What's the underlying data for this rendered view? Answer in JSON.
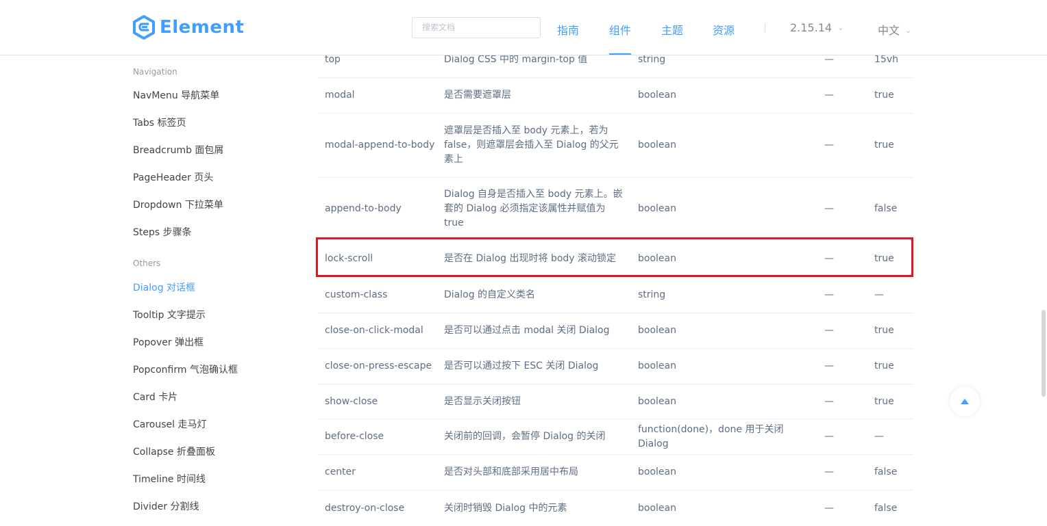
{
  "header": {
    "logo_text": "Element",
    "search_placeholder": "搜索文档",
    "nav": [
      "指南",
      "组件",
      "主题",
      "资源"
    ],
    "active_nav": "组件",
    "version": "2.15.14",
    "language": "中文",
    "accent_color": "#409eff"
  },
  "sidebar": {
    "groups": [
      {
        "title": "Navigation",
        "items": [
          "NavMenu 导航菜单",
          "Tabs 标签页",
          "Breadcrumb 面包屑",
          "PageHeader 页头",
          "Dropdown 下拉菜单",
          "Steps 步骤条"
        ]
      },
      {
        "title": "Others",
        "items": [
          "Dialog 对话框",
          "Tooltip 文字提示",
          "Popover 弹出框",
          "Popconfirm 气泡确认框",
          "Card 卡片",
          "Carousel 走马灯",
          "Collapse 折叠面板",
          "Timeline 时间线",
          "Divider 分割线"
        ]
      }
    ],
    "active_item": "Dialog 对话框"
  },
  "table": {
    "rows": [
      [
        "top",
        "Dialog CSS 中的 margin-top 值",
        "string",
        "—",
        "15vh"
      ],
      [
        "modal",
        "是否需要遮罩层",
        "boolean",
        "—",
        "true"
      ],
      [
        "modal-append-to-body",
        "遮罩层是否插入至 body 元素上，若为 false，则遮罩层会插入至 Dialog 的父元素上",
        "boolean",
        "—",
        "true"
      ],
      [
        "append-to-body",
        "Dialog 自身是否插入至 body 元素上。嵌套的 Dialog 必须指定该属性并赋值为 true",
        "boolean",
        "—",
        "false"
      ],
      [
        "lock-scroll",
        "是否在 Dialog 出现时将 body 滚动锁定",
        "boolean",
        "—",
        "true"
      ],
      [
        "custom-class",
        "Dialog 的自定义类名",
        "string",
        "—",
        "—"
      ],
      [
        "close-on-click-modal",
        "是否可以通过点击 modal 关闭 Dialog",
        "boolean",
        "—",
        "true"
      ],
      [
        "close-on-press-escape",
        "是否可以通过按下 ESC 关闭 Dialog",
        "boolean",
        "—",
        "true"
      ],
      [
        "show-close",
        "是否显示关闭按钮",
        "boolean",
        "—",
        "true"
      ],
      [
        "before-close",
        "关闭前的回调，会暂停 Dialog 的关闭",
        "function(done)，done 用于关闭 Dialog",
        "—",
        "—"
      ],
      [
        "center",
        "是否对头部和底部采用居中布局",
        "boolean",
        "—",
        "false"
      ],
      [
        "destroy-on-close",
        "关闭时销毁 Dialog 中的元素",
        "boolean",
        "—",
        "false"
      ]
    ],
    "highlighted_row": "lock-scroll",
    "highlight_color": "#e0171c"
  }
}
